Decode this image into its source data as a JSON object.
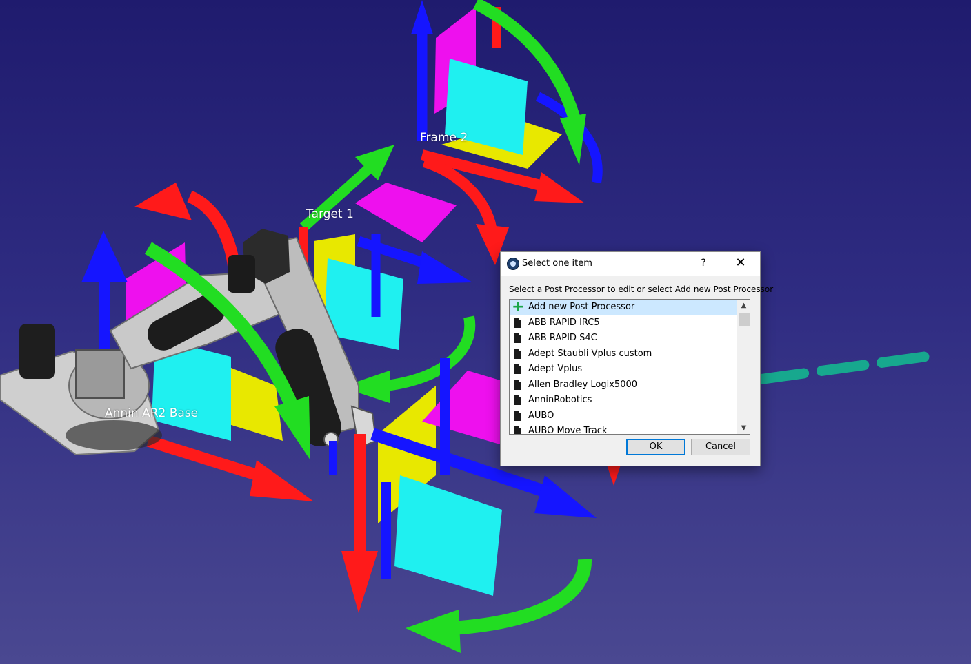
{
  "scene": {
    "labels": {
      "frame2": "Frame 2",
      "target1": "Target 1",
      "base": "Annin AR2 Base"
    }
  },
  "dialog": {
    "title": "Select one item",
    "help_label": "?",
    "close_label": "✕",
    "prompt": "Select a Post Processor to edit or select Add new Post Processor",
    "items": [
      {
        "label": "Add new Post Processor",
        "icon": "plus-icon",
        "selected": true
      },
      {
        "label": "ABB RAPID IRC5",
        "icon": "document-icon"
      },
      {
        "label": "ABB RAPID S4C",
        "icon": "document-icon"
      },
      {
        "label": "Adept Staubli Vplus custom",
        "icon": "document-icon"
      },
      {
        "label": "Adept Vplus",
        "icon": "document-icon"
      },
      {
        "label": "Allen Bradley Logix5000",
        "icon": "document-icon"
      },
      {
        "label": "AnninRobotics",
        "icon": "document-icon"
      },
      {
        "label": "AUBO",
        "icon": "document-icon"
      },
      {
        "label": "AUBO Move Track",
        "icon": "document-icon"
      }
    ],
    "ok_label": "OK",
    "cancel_label": "Cancel"
  },
  "colors": {
    "x_axis": "#ff1a1a",
    "y_axis": "#22dd22",
    "z_axis": "#1515ff",
    "plane_cyan": "#1ff0f0",
    "plane_yellow": "#e8e800",
    "plane_magenta": "#ee10ee",
    "annotation_arrow": "#17a88e",
    "selection": "#cce8ff"
  }
}
